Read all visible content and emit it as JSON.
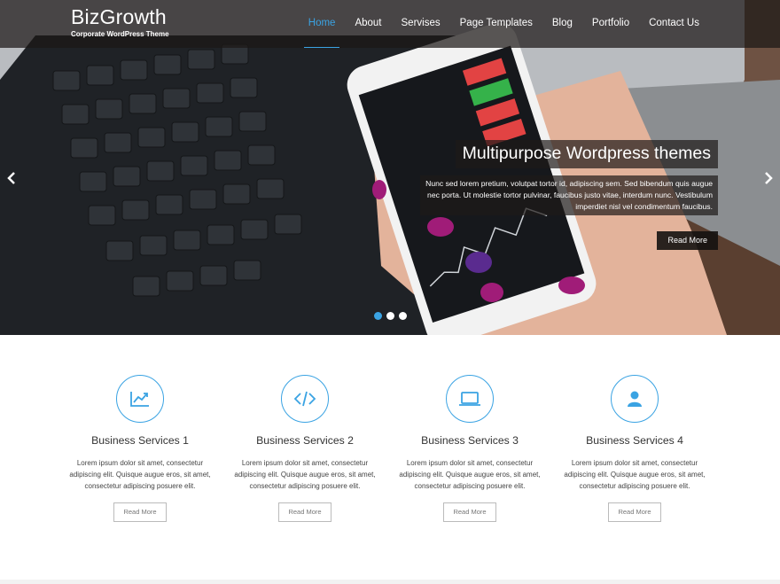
{
  "brand": {
    "name": "BizGrowth",
    "tagline": "Corporate WordPress Theme"
  },
  "nav": [
    {
      "label": "Home",
      "active": true
    },
    {
      "label": "About"
    },
    {
      "label": "Servises"
    },
    {
      "label": "Page Templates"
    },
    {
      "label": "Blog"
    },
    {
      "label": "Portfolio"
    },
    {
      "label": "Contact Us"
    }
  ],
  "slider": {
    "title": "Multipurpose Wordpress themes",
    "text": "Nunc sed lorem pretium, volutpat tortor id, adipiscing sem. Sed bibendum quis augue nec porta. Ut molestie tortor pulvinar, faucibus justo vitae, interdum nunc. Vestibulum imperdiet nisl vel condimentum faucibus.",
    "button": "Read More",
    "prev_icon": "chevron-left-icon",
    "next_icon": "chevron-right-icon",
    "slides": 3,
    "active_slide": 1
  },
  "phone": {
    "tickers": [
      "AAPL",
      "GOOG",
      "FB",
      "DOW J"
    ],
    "values": [
      "106.82",
      "501.79",
      "74.05",
      "320.71"
    ],
    "changes": [
      "626.58",
      "340.4B",
      "206.4B"
    ]
  },
  "services": [
    {
      "icon": "chart-line-icon",
      "title": "Business Services 1",
      "text": "Lorem ipsum dolor sit amet, consectetur adipiscing elit. Quisque augue eros, sit amet, consectetur adipiscing posuere elit.",
      "button": "Read More"
    },
    {
      "icon": "code-icon",
      "title": "Business Services 2",
      "text": "Lorem ipsum dolor sit amet, consectetur adipiscing elit. Quisque augue eros, sit amet, consectetur adipiscing posuere elit.",
      "button": "Read More"
    },
    {
      "icon": "laptop-icon",
      "title": "Business Services 3",
      "text": "Lorem ipsum dolor sit amet, consectetur adipiscing elit. Quisque augue eros, sit amet, consectetur adipiscing posuere elit.",
      "button": "Read More"
    },
    {
      "icon": "user-icon",
      "title": "Business Services 4",
      "text": "Lorem ipsum dolor sit amet, consectetur adipiscing elit. Quisque augue eros, sit amet, consectetur adipiscing posuere elit.",
      "button": "Read More"
    }
  ],
  "colors": {
    "accent": "#3aa3e3",
    "header_bg": "#1c1816"
  }
}
